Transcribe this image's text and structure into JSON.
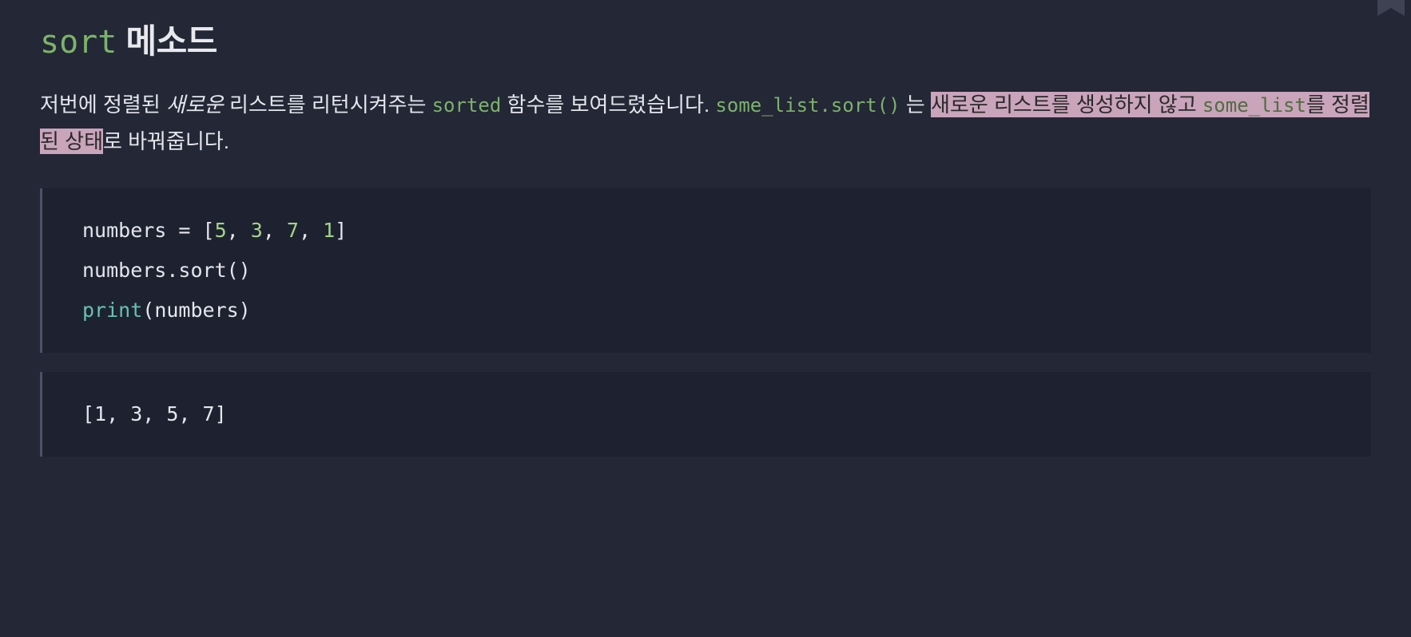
{
  "heading": {
    "code": "sort",
    "rest": " 메소드"
  },
  "paragraph": {
    "seg1": "저번에 정렬된 ",
    "italic": "새로운",
    "seg2": " 리스트를 리턴시켜주는 ",
    "code1": "sorted",
    "seg3": " 함수를 보여드렸습니다. ",
    "code2": "some_list.sort()",
    "seg4": " 는 ",
    "hl1": "새로운 리스트를 생성하지 않고 ",
    "hl_code": "some_list",
    "hl2": "를 정렬된 상태",
    "seg5": "로 바꿔줍니다."
  },
  "code": {
    "line1_a": "numbers = [",
    "n1": "5",
    "c": ", ",
    "n2": "3",
    "n3": "7",
    "n4": "1",
    "line1_b": "]",
    "line2": "numbers.sort()",
    "line3_fn": "print",
    "line3_rest": "(numbers)"
  },
  "output": {
    "line1": "[1, 3, 5, 7]"
  }
}
